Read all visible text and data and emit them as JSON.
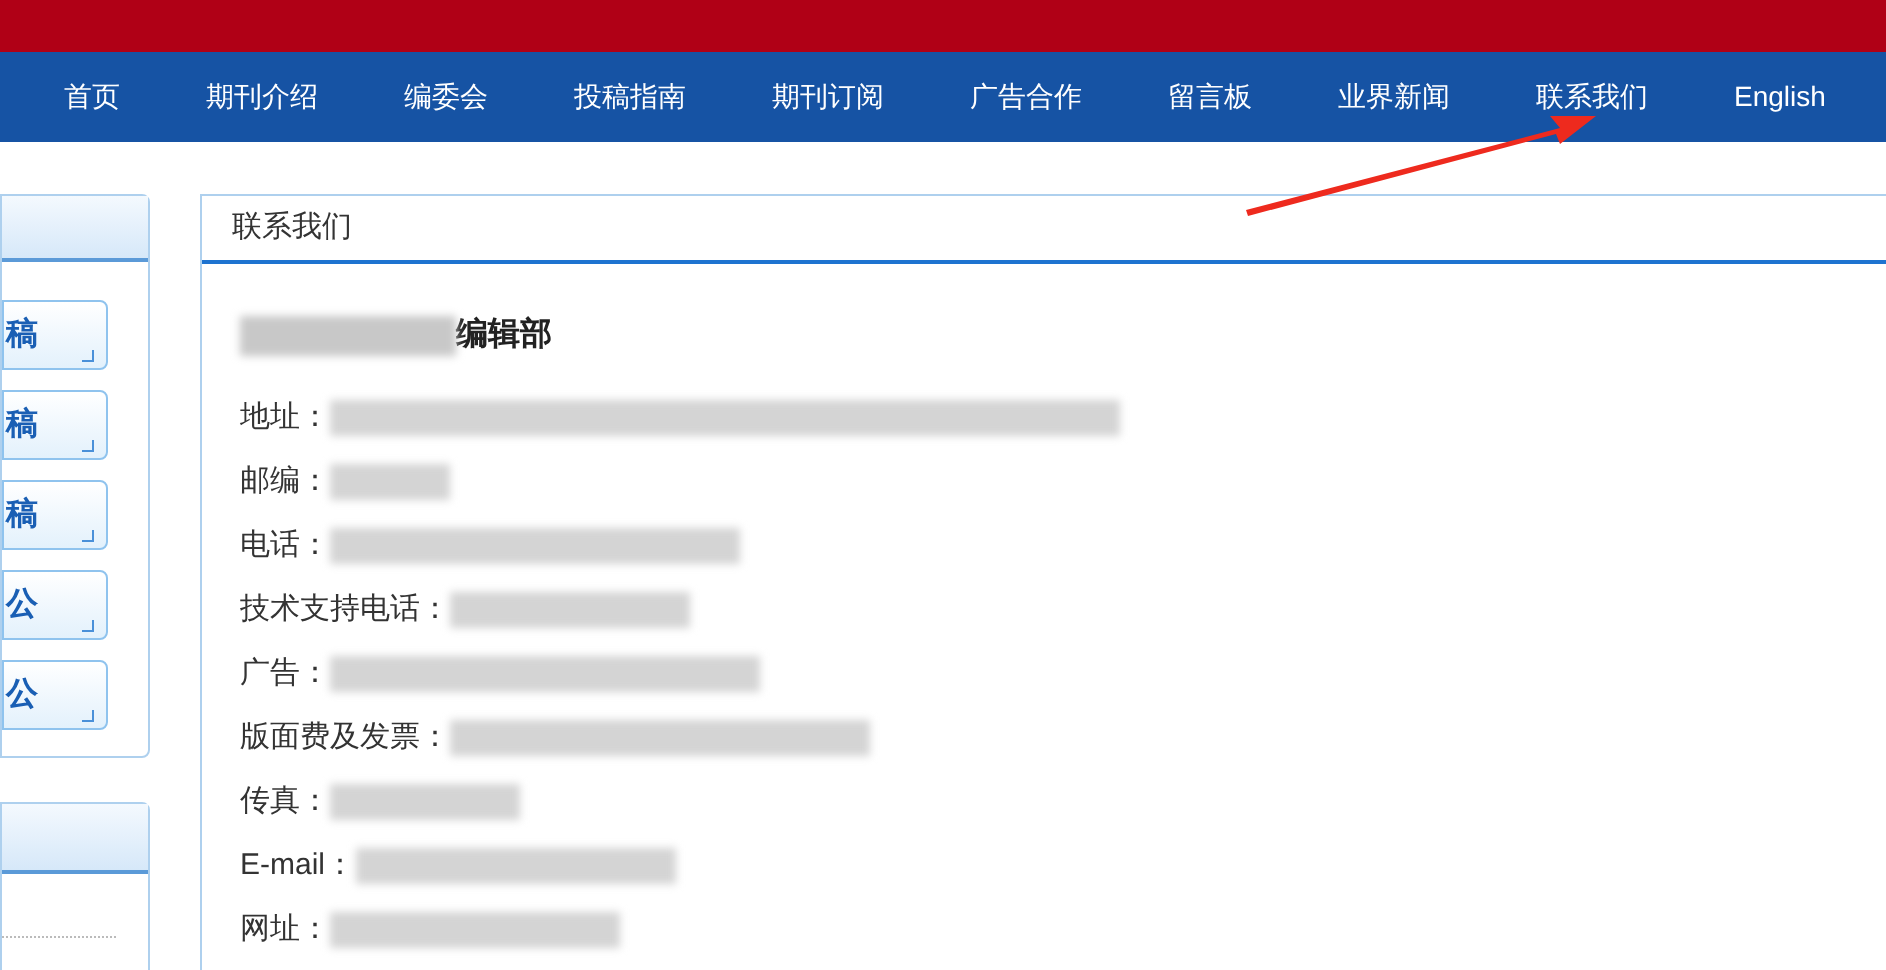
{
  "nav": [
    "首页",
    "期刊介绍",
    "编委会",
    "投稿指南",
    "期刊订阅",
    "广告合作",
    "留言板",
    "业界新闻",
    "联系我们",
    "English"
  ],
  "sidebar": {
    "buttons": [
      "稿",
      "稿",
      "稿",
      "公",
      "公"
    ]
  },
  "panel": {
    "title": "联系我们",
    "heading": "编辑部",
    "fields": [
      {
        "label": "地址："
      },
      {
        "label": "邮编："
      },
      {
        "label": "电话："
      },
      {
        "label": "技术支持电话："
      },
      {
        "label": "广告："
      },
      {
        "label": "版面费及发票："
      },
      {
        "label": "传真："
      },
      {
        "label": "E-mail："
      },
      {
        "label": "网址："
      }
    ]
  }
}
